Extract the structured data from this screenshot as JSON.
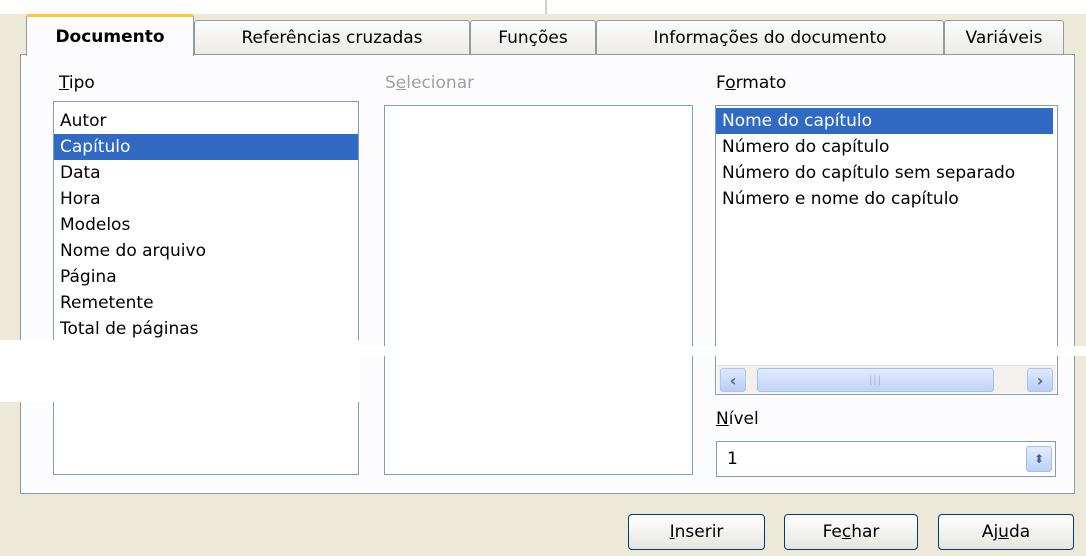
{
  "tabs": [
    {
      "label": "Documento",
      "active": true
    },
    {
      "label": "Referências cruzadas"
    },
    {
      "label": "Funções"
    },
    {
      "label": "Informações do documento"
    },
    {
      "label": "Variáveis"
    }
  ],
  "tipo": {
    "label_mnemonic": "T",
    "label_rest": "ipo",
    "items": [
      "Autor",
      "Capítulo",
      "Data",
      "Hora",
      "Modelos",
      "Nome do arquivo",
      "Página",
      "Remetente",
      "Total de páginas"
    ],
    "selected": "Capítulo"
  },
  "selecionar": {
    "label_pre": "S",
    "label_mnemonic": "e",
    "label_rest": "lecionar"
  },
  "formato": {
    "label_pre": "F",
    "label_mnemonic": "o",
    "label_rest": "rmato",
    "items": [
      "Nome do capítulo",
      "Número do capítulo",
      "Número do capítulo sem separado",
      "Número e nome do capítulo"
    ],
    "selected": "Nome do capítulo"
  },
  "nivel": {
    "label_mnemonic": "N",
    "label_rest": "ível",
    "value": "1"
  },
  "buttons": {
    "inserir_mnemonic": "I",
    "inserir_rest": "nserir",
    "fechar_pre": "Fe",
    "fechar_mnemonic": "c",
    "fechar_rest": "har",
    "ajuda_pre": "Aj",
    "ajuda_mnemonic": "u",
    "ajuda_rest": "da"
  },
  "colors": {
    "selection": "#316AC5",
    "tab_highlight": "#FFC73C",
    "dialog_bg": "#ECE9D8"
  }
}
